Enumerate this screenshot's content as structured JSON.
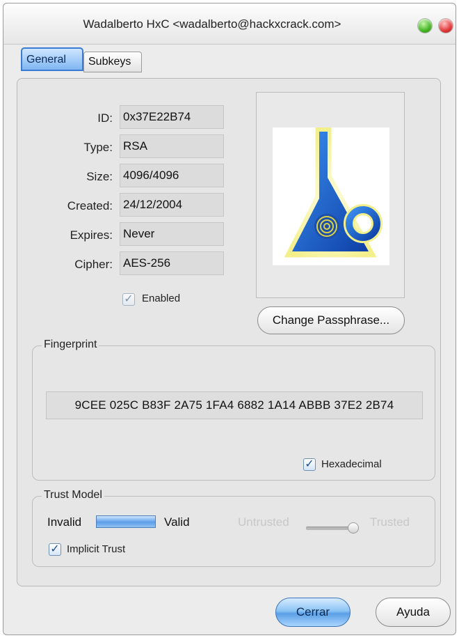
{
  "window": {
    "title": "Wadalberto HxC <wadalberto@hackxcrack.com>"
  },
  "tabs": [
    {
      "label": "General",
      "active": true
    },
    {
      "label": "Subkeys",
      "active": false
    }
  ],
  "key_info": {
    "fields": [
      {
        "label": "ID:",
        "value": "0x37E22B74"
      },
      {
        "label": "Type:",
        "value": "RSA"
      },
      {
        "label": "Size:",
        "value": "4096/4096"
      },
      {
        "label": "Created:",
        "value": "24/12/2004"
      },
      {
        "label": "Expires:",
        "value": "Never"
      },
      {
        "label": "Cipher:",
        "value": "AES-256"
      }
    ],
    "enabled": {
      "label": "Enabled",
      "checked": true
    }
  },
  "photo": {
    "icon": "pgp-key-logo-icon"
  },
  "change_passphrase_label": "Change Passphrase...",
  "fingerprint": {
    "title": "Fingerprint",
    "value": "9CEE 025C B83F 2A75 1FA4  6882 1A14 ABBB 37E2 2B74",
    "hexadecimal": {
      "label": "Hexadecimal",
      "checked": true
    }
  },
  "trust_model": {
    "title": "Trust Model",
    "invalid_label": "Invalid",
    "valid_label": "Valid",
    "validity_level": 1.0,
    "untrusted_label": "Untrusted",
    "trusted_label": "Trusted",
    "trust_level": 1.0,
    "implicit_trust": {
      "label": "Implicit Trust",
      "checked": true
    }
  },
  "buttons": {
    "close_label": "Cerrar",
    "help_label": "Ayuda"
  },
  "colors": {
    "accent_blue": "#5b9fe6",
    "window_bg": "#ececec"
  }
}
